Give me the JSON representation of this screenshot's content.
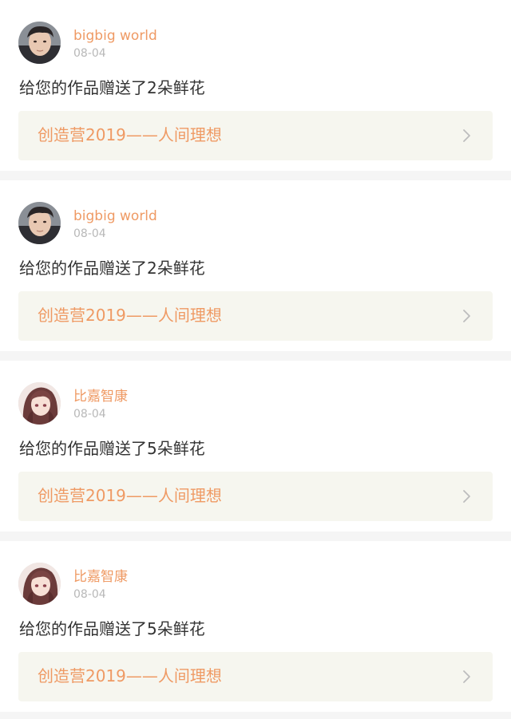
{
  "notifications": [
    {
      "username": "bigbig world",
      "date": "08-04",
      "message": "给您的作品赠送了2朵鲜花",
      "work_title": "创造营2019——人间理想",
      "avatar": "male-avatar"
    },
    {
      "username": "bigbig world",
      "date": "08-04",
      "message": "给您的作品赠送了2朵鲜花",
      "work_title": "创造营2019——人间理想",
      "avatar": "male-avatar"
    },
    {
      "username": "比嘉智康",
      "date": "08-04",
      "message": "给您的作品赠送了5朵鲜花",
      "work_title": "创造营2019——人间理想",
      "avatar": "anime-girl-avatar"
    },
    {
      "username": "比嘉智康",
      "date": "08-04",
      "message": "给您的作品赠送了5朵鲜花",
      "work_title": "创造营2019——人间理想",
      "avatar": "anime-girl-avatar"
    }
  ],
  "colors": {
    "accent": "#ef9a64",
    "meta_text": "#b8b8b8",
    "body_text": "#333333",
    "link_bg": "#f6f6ef",
    "page_bg": "#f5f5f5"
  },
  "icons": {
    "chevron": "chevron-right-icon"
  }
}
